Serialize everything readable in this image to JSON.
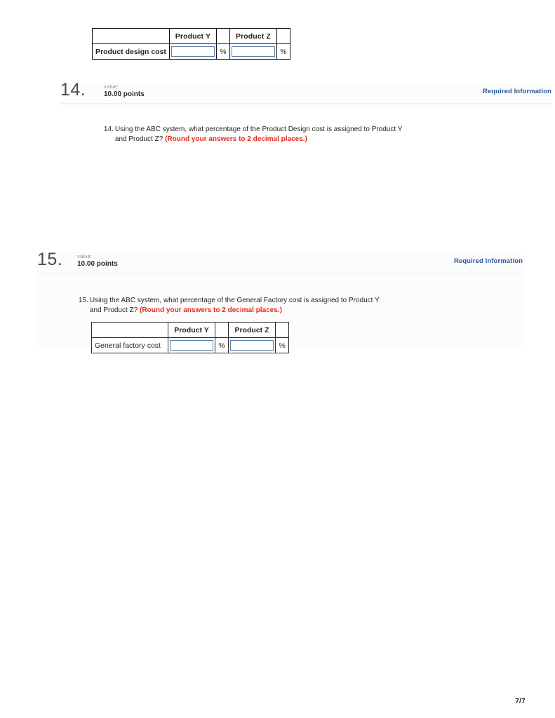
{
  "document": {
    "page_number": "7/7"
  },
  "top_table": {
    "headers": [
      "",
      "Product Y",
      "",
      "Product Z",
      ""
    ],
    "row_label": "Product design cost",
    "percent_symbol": "%",
    "product_y_value": "",
    "product_z_value": "",
    "input_placeholder": ""
  },
  "questions": [
    {
      "number": "14.",
      "value_label": "value:",
      "points": "10.00 points",
      "required_information": "Required Information",
      "text_number": "14.",
      "text_part1": "Using the ABC system, what percentage of the Product Design cost is assigned to Product Y and Product Z? ",
      "text_round": "(Round your answers to 2 decimal places.)"
    },
    {
      "number": "15.",
      "value_label": "value:",
      "points": "10.00 points",
      "required_information": "Required Information",
      "text_number": "15.",
      "text_part1": "Using the ABC system, what percentage of the General Factory cost is assigned to Product Y and Product Z? ",
      "text_round": "(Round your answers to 2 decimal places.)",
      "table": {
        "headers": [
          "",
          "Product Y",
          "",
          "Product Z",
          ""
        ],
        "row_label": "General factory cost",
        "percent_symbol": "%",
        "product_y_value": "",
        "product_z_value": "",
        "input_placeholder": ""
      }
    }
  ],
  "colors": {
    "link_blue": "#2a5699",
    "alert_red": "#e02b20",
    "input_border": "#5d7fa8",
    "table_border": "#2b2b2b",
    "block_background": "#fcfcfd"
  }
}
